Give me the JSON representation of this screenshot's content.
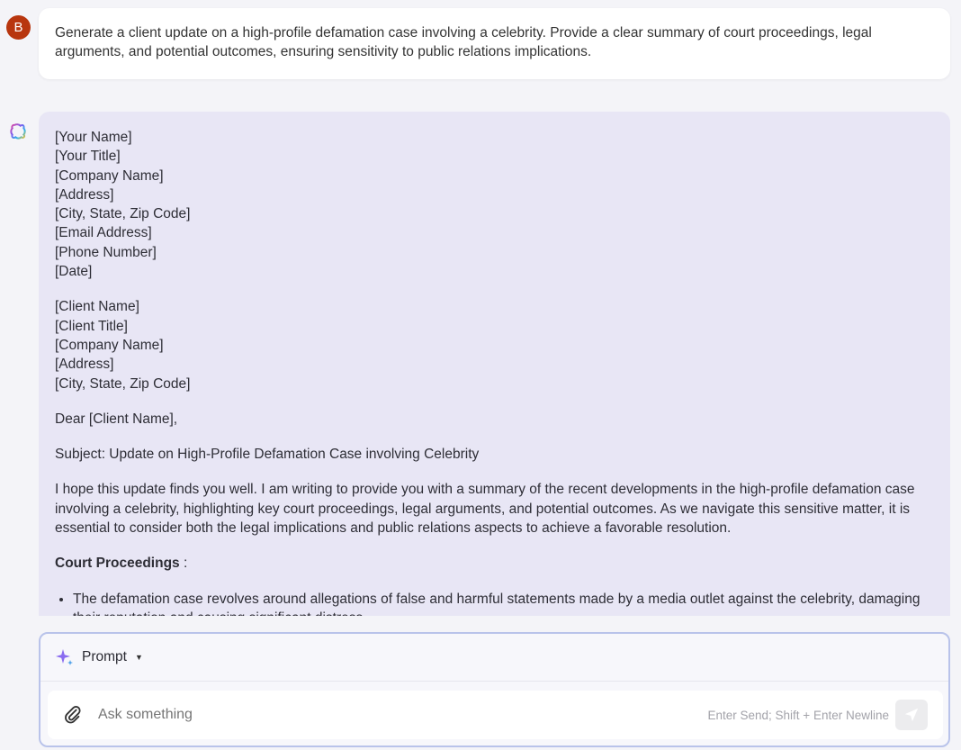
{
  "user": {
    "avatar_initial": "B",
    "avatar_color": "#b8360f",
    "message": "Generate a client update on a high-profile defamation case involving a celebrity. Provide a clear summary of court proceedings, legal arguments, and potential outcomes, ensuring sensitivity to public relations implications."
  },
  "assistant": {
    "sender_block": [
      "[Your Name]",
      "[Your Title]",
      "[Company Name]",
      "[Address]",
      "[City, State, Zip Code]",
      "[Email Address]",
      "[Phone Number]",
      "[Date]"
    ],
    "recipient_block": [
      "[Client Name]",
      "[Client Title]",
      "[Company Name]",
      "[Address]",
      "[City, State, Zip Code]"
    ],
    "salutation": "Dear [Client Name],",
    "subject": "Subject: Update on High-Profile Defamation Case involving Celebrity",
    "intro": "I hope this update finds you well. I am writing to provide you with a summary of the recent developments in the high-profile defamation case involving a celebrity, highlighting key court proceedings, legal arguments, and potential outcomes. As we navigate this sensitive matter, it is essential to consider both the legal implications and public relations aspects to achieve a favorable resolution.",
    "section_heading": "Court Proceedings",
    "section_suffix": " :",
    "bullets": [
      "The defamation case revolves around allegations of false and harmful statements made by a media outlet against the celebrity, damaging their reputation and causing significant distress."
    ]
  },
  "composer": {
    "mode_label": "Prompt",
    "placeholder": "Ask something",
    "hint": "Enter Send; Shift + Enter Newline"
  }
}
